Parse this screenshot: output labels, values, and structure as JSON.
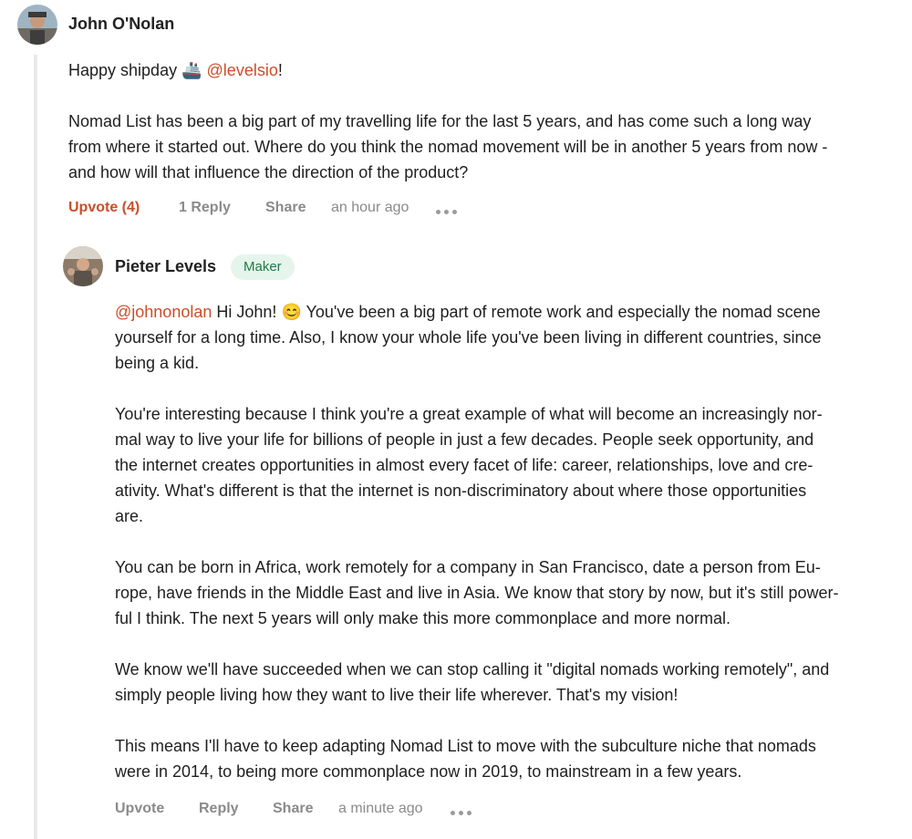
{
  "comment": {
    "author": "John O'Nolan",
    "greeting_text": "Happy shipday",
    "ship_emoji": "🚢",
    "greeting_mention": "@levelsio",
    "greeting_punct": "!",
    "body_lines": [
      "Nomad List has been a big part of my travelling life for the last 5 years, and has come such a long way",
      "from where it started out. Where do you think the nomad movement will be in another 5 years from now -",
      "and how will that influence the direction of the product?"
    ],
    "actions": {
      "upvote": "Upvote (4)",
      "reply": "1 Reply",
      "share": "Share",
      "time": "an hour ago"
    }
  },
  "reply": {
    "author": "Pieter Levels",
    "badge": "Maker",
    "mention": "@johnonolan",
    "first_line_rest": "Hi John!",
    "smile_emoji": "😊",
    "first_line_tail": "You've been a big part of remote work and especially the nomad scene",
    "para1_lines": [
      "yourself for a long time. Also, I know your whole life you've been living in different countries, since",
      "being a kid."
    ],
    "para2_lines": [
      "You're interesting because I think you're a great example of what will become an increasingly nor-",
      "mal way to live your life for billions of people in just a few decades. People seek opportunity, and",
      "the internet creates opportunities in almost every facet of life: career, relationships, love and cre-",
      "ativity. What's different is that the internet is non-discriminatory about where those opportunities",
      "are."
    ],
    "para3_lines": [
      "You can be born in Africa, work remotely for a company in San Francisco, date a person from Eu-",
      "rope, have friends in the Middle East and live in Asia. We know that story by now, but it's still power-",
      "ful I think. The next 5 years will only make this more commonplace and more normal."
    ],
    "para4_lines": [
      "We know we'll have succeeded when we can stop calling it \"digital nomads working remotely\", and",
      "simply people living how they want to live their life wherever. That's my vision!"
    ],
    "para5_lines": [
      "This means I'll have to keep adapting Nomad List to move with the subculture niche that nomads",
      "were in 2014, to being more commonplace now in 2019, to mainstream in a few years."
    ],
    "actions": {
      "upvote": "Upvote",
      "reply": "Reply",
      "share": "Share",
      "time": "a minute ago"
    }
  },
  "colors": {
    "mention": "#cc4d29",
    "badge_bg": "#e6f5ec",
    "badge_text": "#1f7a45",
    "action_gray": "#8a8a8a"
  }
}
